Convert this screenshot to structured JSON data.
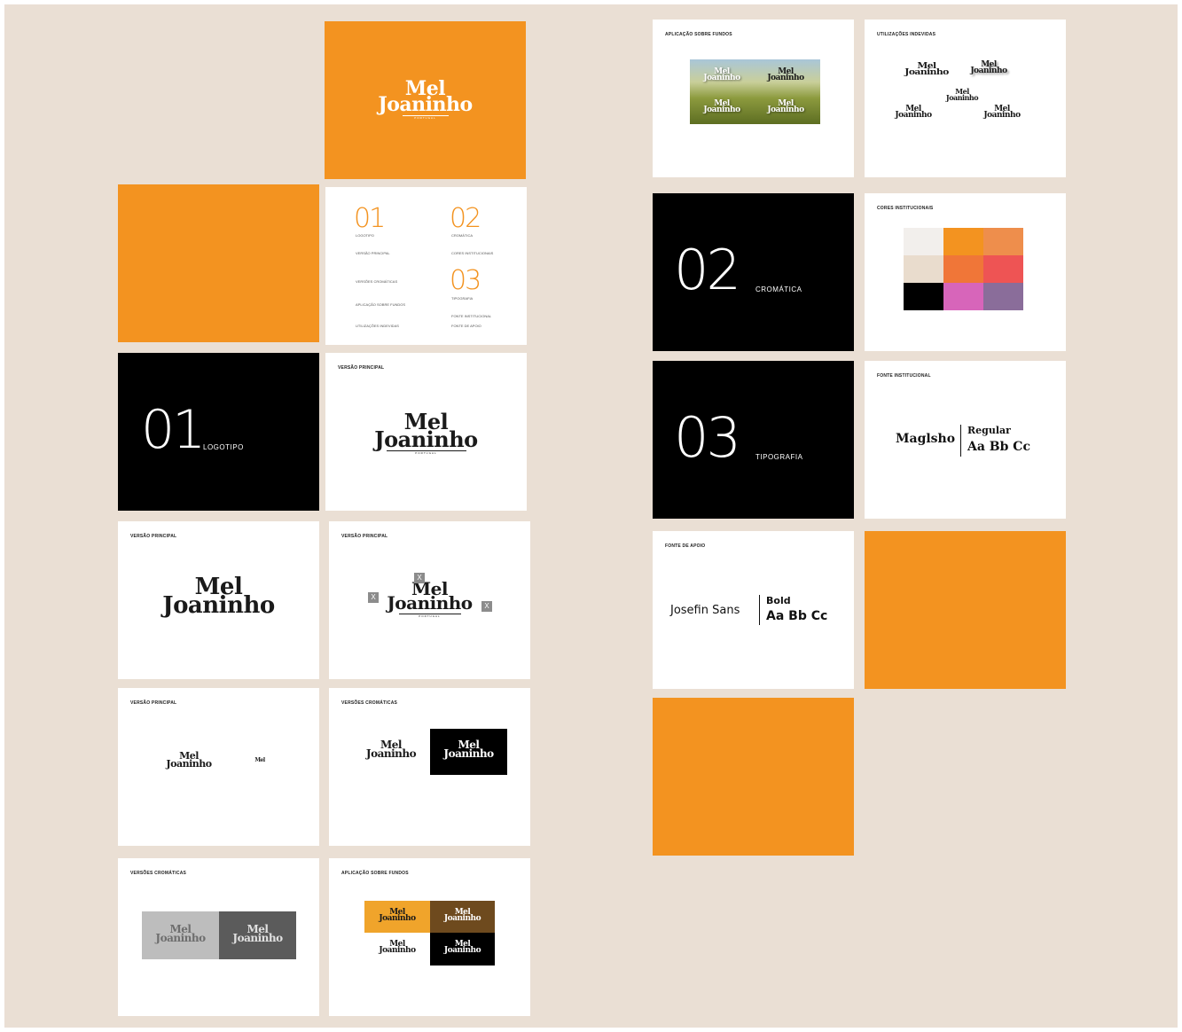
{
  "brand": {
    "line1": "Mel",
    "line2": "Joaninho",
    "tagline": "PORTUGAL"
  },
  "colors": {
    "orange": "#f39320",
    "black": "#000000",
    "background": "#eadfd4"
  },
  "index": {
    "n1": "01",
    "t1": "LOGOTIPO",
    "n2": "02",
    "t2": "CROMÁTICA",
    "n3": "03",
    "t3": "TIPOGRAFIA",
    "item1": "VERSÃO PRINCIPAL",
    "item2": "VERSÕES CROMÁTICAS",
    "item3": "APLICAÇÃO SOBRE FUNDOS",
    "item4": "UTILIZAÇÕES INDEVIDAS",
    "item5": "CORES INSTITUCIONAIS",
    "item6": "FONTE INSTITUCIONAL",
    "item7": "FONTE DE APOIO"
  },
  "sections": {
    "s1_num": "01",
    "s1_word": "LOGOTIPO",
    "s2_num": "02",
    "s2_word": "CROMÁTICA",
    "s3_num": "03",
    "s3_word": "TIPOGRAFIA"
  },
  "titles": {
    "versao_principal": "VERSÃO PRINCIPAL",
    "versoes_cromaticas": "VERSÕES CROMÁTICAS",
    "aplicacao_fundos": "APLICAÇÃO SOBRE FUNDOS",
    "utilizacoes_indevidas": "UTILIZAÇÕES INDEVIDAS",
    "cores_institucionais": "CORES INSTITUCIONAIS",
    "fonte_institucional": "FONTE INSTITUCIONAL",
    "fonte_apoio": "FONTE DE APOIO"
  },
  "fonts": {
    "inst_name": "Maglsho",
    "inst_weight": "Regular",
    "inst_sample": "Aa Bb Cc",
    "apoio_name": "Josefin Sans",
    "apoio_weight": "Bold",
    "apoio_sample": "Aa Bb Cc"
  },
  "misc": {
    "x_mark": "X"
  },
  "palette": [
    "#f2efec",
    "#f39320",
    "#ee8e4c",
    "#e9dccd",
    "#f07638",
    "#ee5454",
    "#000000",
    "#d765ba",
    "#8a6d9a"
  ]
}
